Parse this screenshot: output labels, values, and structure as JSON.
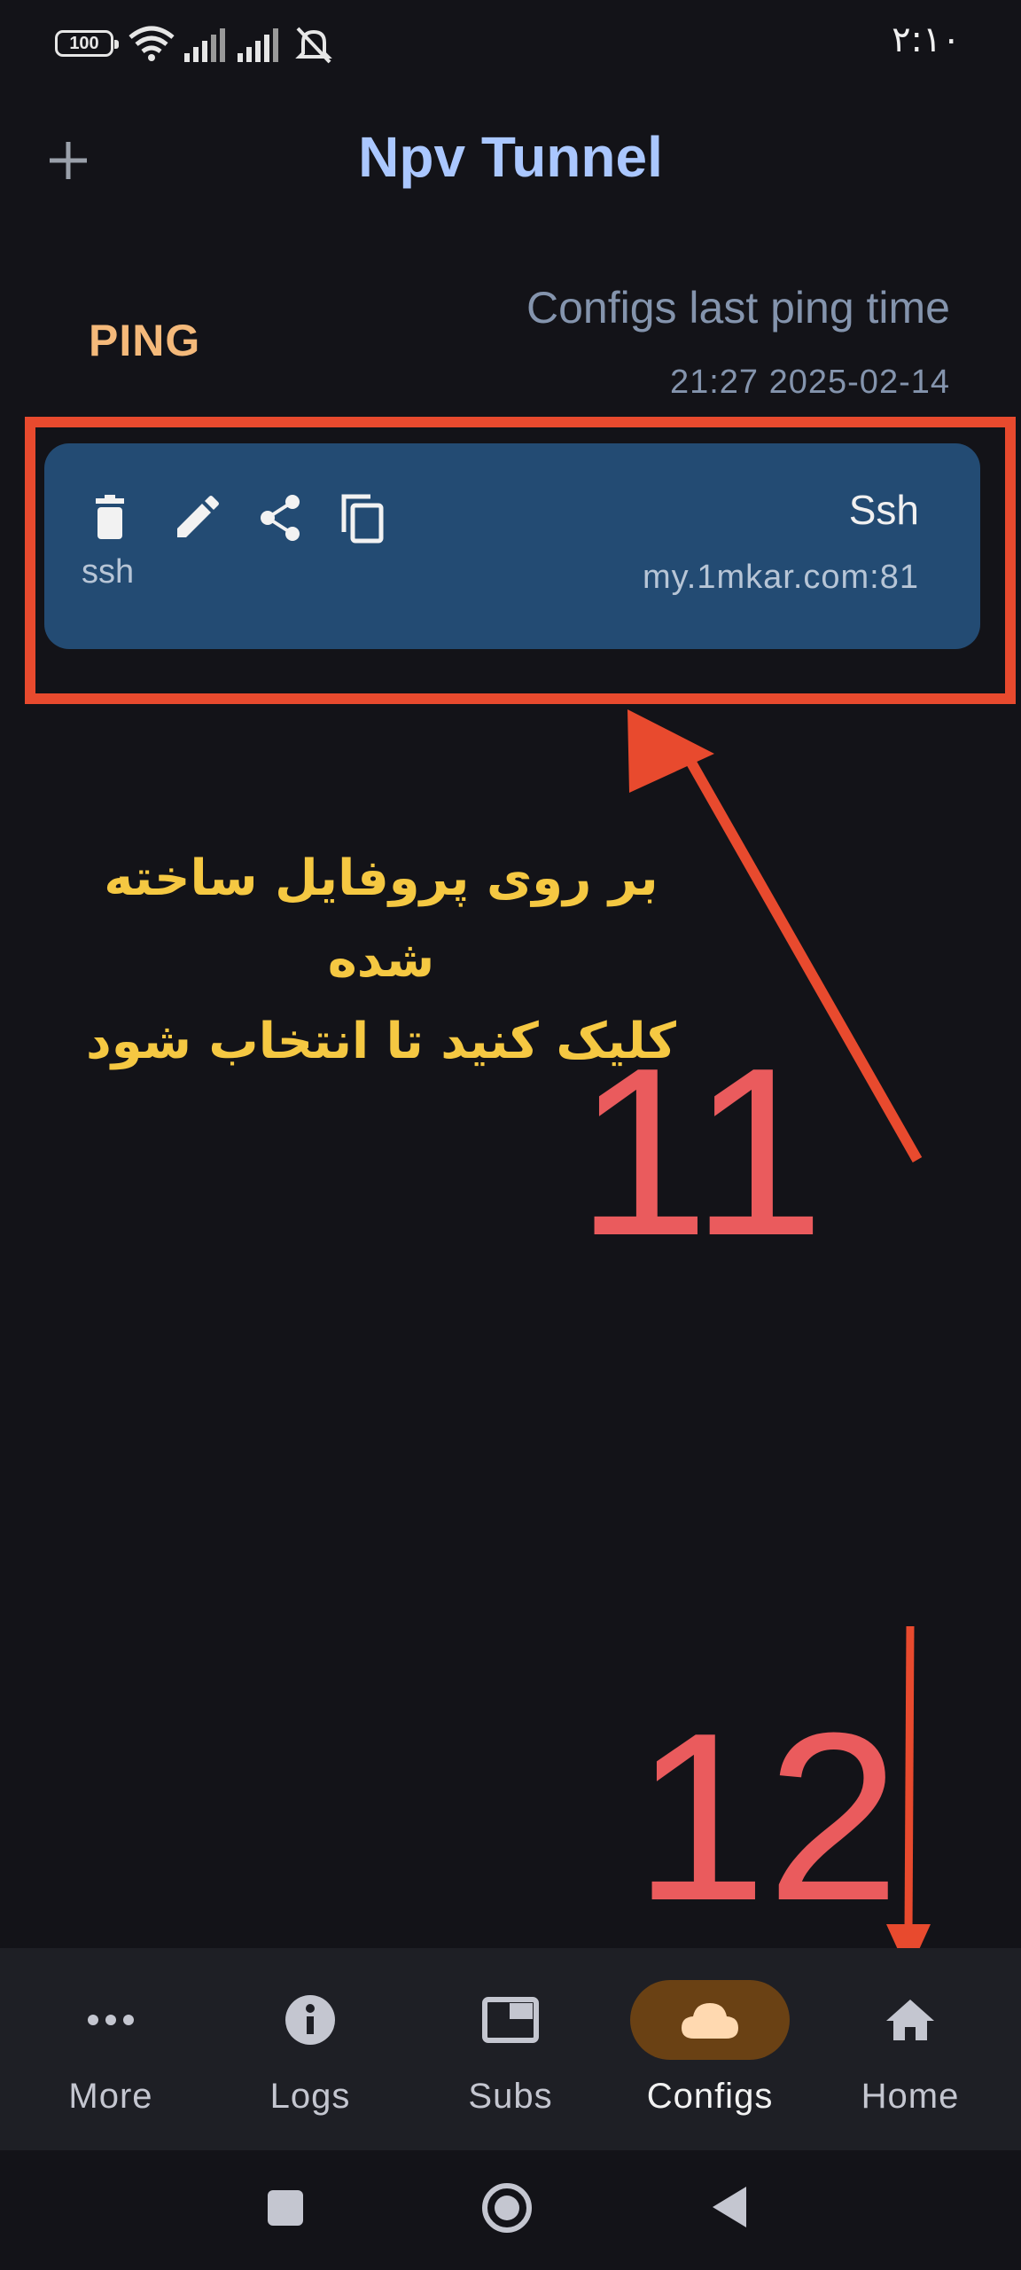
{
  "status_bar": {
    "battery": "100",
    "clock": "۲:۱۰"
  },
  "app": {
    "title": "Npv Tunnel"
  },
  "ping": {
    "button_label": "PING",
    "title": "Configs last ping time",
    "timestamp": "21:27 2025-02-14"
  },
  "config": {
    "type": "ssh",
    "name": "Ssh",
    "host": "my.1mkar.com:81",
    "actions": [
      "delete-icon",
      "edit-icon",
      "share-icon",
      "copy-icon"
    ]
  },
  "annotations": {
    "instruction_line1": "بر روی پروفایل ساخته شده",
    "instruction_line2": "کلیک کنید تا انتخاب شود",
    "step_a": "11",
    "step_b": "12",
    "highlight_color": "#e84a2e"
  },
  "nav": {
    "items": [
      {
        "label": "More",
        "icon": "more-icon",
        "active": false
      },
      {
        "label": "Logs",
        "icon": "info-icon",
        "active": false
      },
      {
        "label": "Subs",
        "icon": "subs-icon",
        "active": false
      },
      {
        "label": "Configs",
        "icon": "cloud-icon",
        "active": true
      },
      {
        "label": "Home",
        "icon": "home-icon",
        "active": false
      }
    ]
  },
  "colors": {
    "background": "#131318",
    "accent_title": "#aac7ff",
    "card": "#234b73",
    "ping": "#f4b97a",
    "active_pill": "#6a4114"
  }
}
